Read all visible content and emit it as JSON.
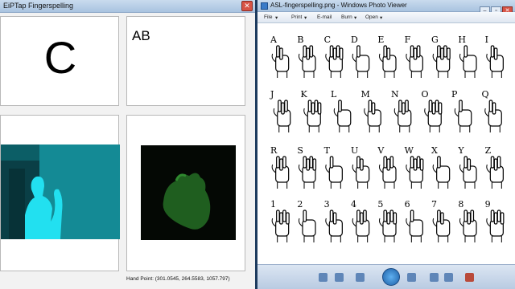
{
  "left_window": {
    "title": "EiPTap Fingerspelling",
    "current_letter": "C",
    "spelled_word": "AB",
    "status": "Hand Point:  (301.0545, 264.5583, 1057.797)"
  },
  "right_window": {
    "title": "ASL-fingerspelling.png - Windows Photo Viewer",
    "menu": [
      "File",
      "Print",
      "E-mail",
      "Burn",
      "Open"
    ],
    "chart_labels": [
      "A",
      "B",
      "C",
      "D",
      "E",
      "F",
      "G",
      "H",
      "I",
      "J",
      "K",
      "L",
      "M",
      "N",
      "O",
      "P",
      "Q",
      "R",
      "S",
      "T",
      "U",
      "V",
      "W",
      "X",
      "Y",
      "Z",
      "1",
      "2",
      "3",
      "4",
      "5",
      "6",
      "7",
      "8",
      "9"
    ]
  },
  "colors": {
    "titlebar": "#a9c3e0",
    "depth_cyan": "#18d6e8",
    "hand_green": "#2a7a2a"
  }
}
